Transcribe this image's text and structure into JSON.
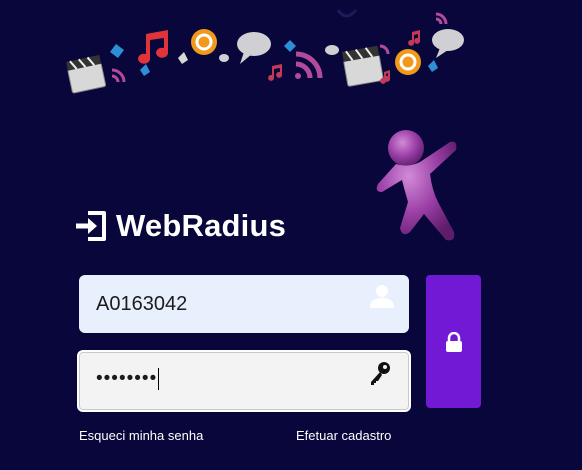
{
  "brand": {
    "name": "WebRadius",
    "icon": "sign-in-icon"
  },
  "login_form": {
    "username": {
      "value": "A0163042",
      "icon": "user-icon"
    },
    "password": {
      "masked_value": "••••••••",
      "icon": "key-icon"
    },
    "submit": {
      "icon": "lock-icon",
      "color": "#7219d6"
    }
  },
  "links": {
    "forgot_password": "Esqueci minha senha",
    "sign_up": "Efetuar cadastro"
  },
  "theme": {
    "background": "#08063a",
    "accent": "#7219d6"
  },
  "decorations": {
    "header_icons": [
      "film-clapper-icon",
      "music-note-icon",
      "email-at-icon",
      "chat-bubble-icon",
      "rss-feed-icon",
      "diamond-icon"
    ],
    "mascot": "purple-figure-mascot"
  }
}
